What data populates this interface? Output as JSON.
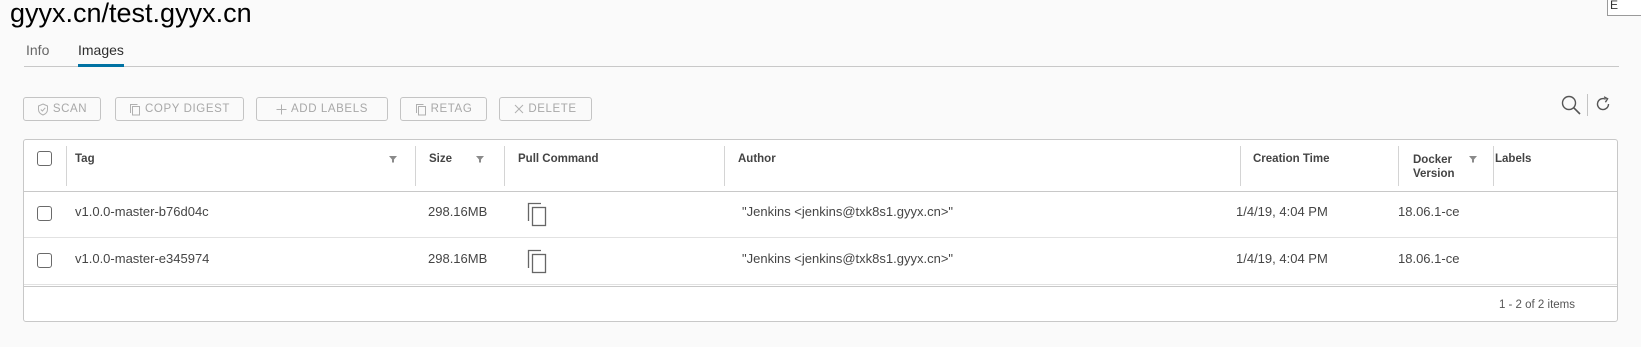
{
  "page": {
    "title": "gyyx.cn/test.gyyx.cn",
    "edge_label": "E"
  },
  "tabs": [
    {
      "label": "Info",
      "active": false
    },
    {
      "label": "Images",
      "active": true
    }
  ],
  "toolbar": {
    "scan": "SCAN",
    "copy_digest": "COPY DIGEST",
    "add_labels": "ADD LABELS",
    "retag": "RETAG",
    "delete": "DELETE"
  },
  "tool_icons": [
    "search-icon",
    "refresh-icon"
  ],
  "table": {
    "columns": {
      "tag": "Tag",
      "size": "Size",
      "pull_command": "Pull Command",
      "author": "Author",
      "creation_time": "Creation Time",
      "docker_version_line1": "Docker",
      "docker_version_line2": "Version",
      "labels": "Labels"
    },
    "rows": [
      {
        "tag": "v1.0.0-master-b76d04c",
        "size": "298.16MB",
        "author": "\"Jenkins <jenkins@txk8s1.gyyx.cn>\"",
        "creation_time": "1/4/19, 4:04 PM",
        "docker_version": "18.06.1-ce",
        "labels": ""
      },
      {
        "tag": "v1.0.0-master-e345974",
        "size": "298.16MB",
        "author": "\"Jenkins <jenkins@txk8s1.gyyx.cn>\"",
        "creation_time": "1/4/19, 4:04 PM",
        "docker_version": "18.06.1-ce",
        "labels": ""
      }
    ],
    "footer": "1 - 2 of 2 items"
  },
  "colors": {
    "accent": "#0072a3",
    "border": "#c8c8c8",
    "disabled_text": "#a8a8a8",
    "background": "#fafafa"
  }
}
